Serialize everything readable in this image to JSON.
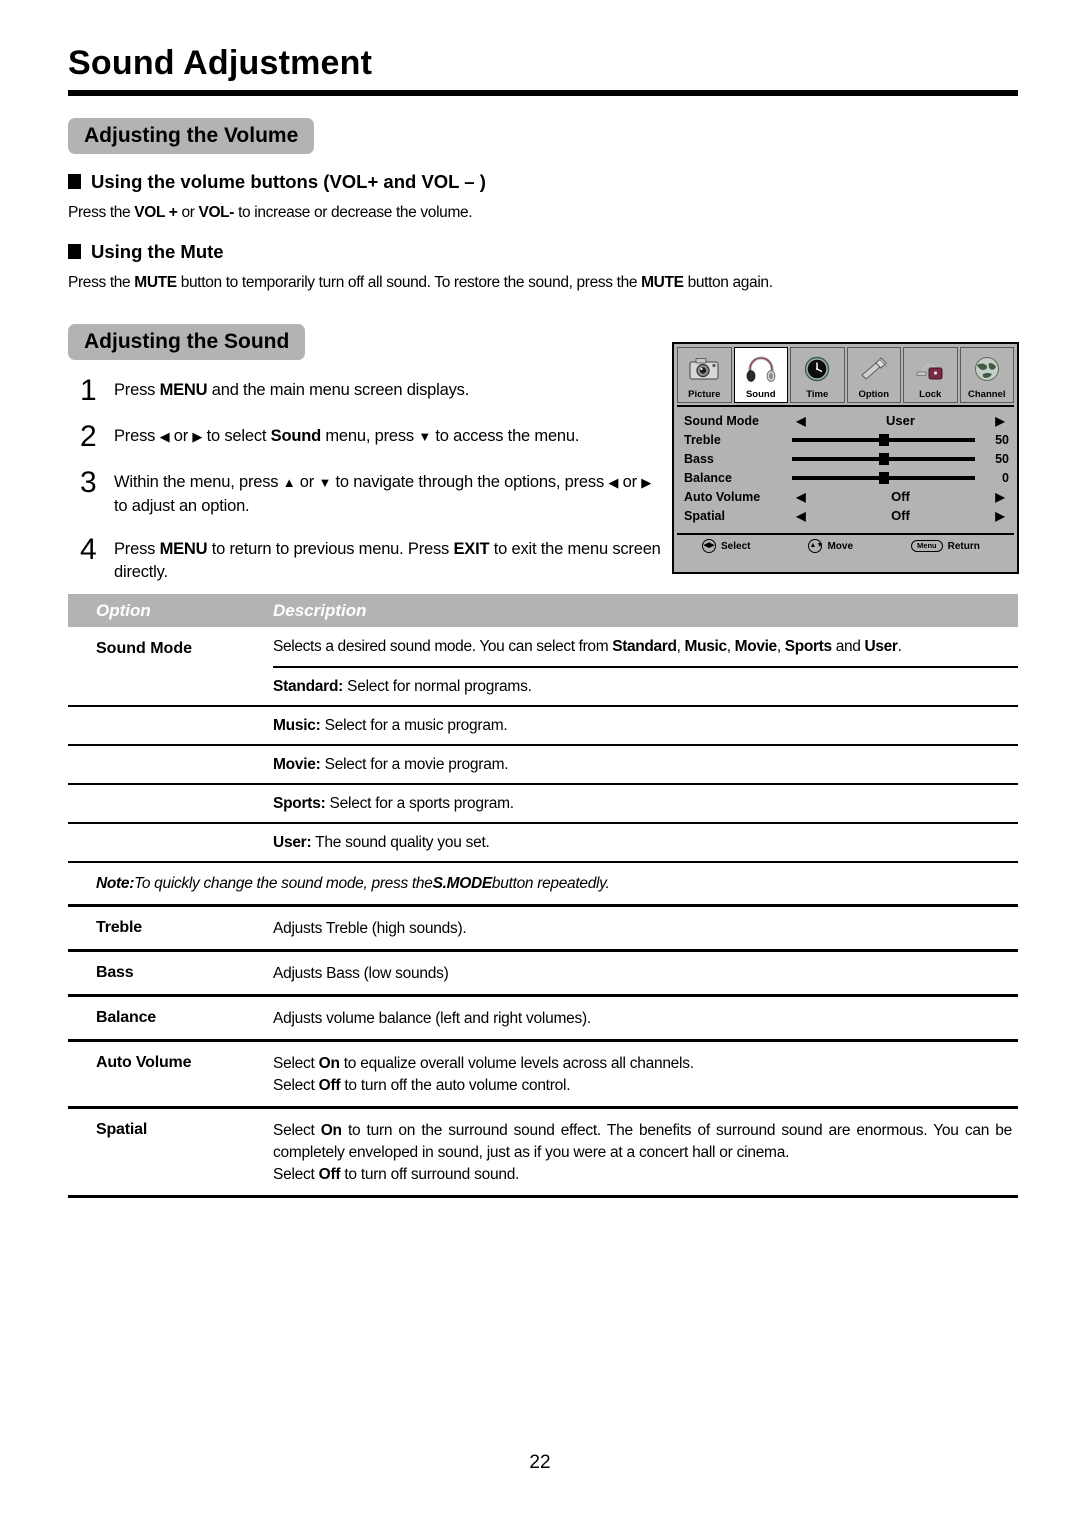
{
  "document": {
    "title": "Sound Adjustment",
    "page_number": "22"
  },
  "volume_section": {
    "badge": "Adjusting the Volume",
    "vol_buttons": {
      "heading": "Using the volume buttons (VOL+ and VOL – )",
      "body_prefix": "Press the ",
      "body_bold1": "VOL +",
      "body_mid": " or ",
      "body_bold2": "VOL-",
      "body_suffix": " to increase or decrease the volume."
    },
    "mute": {
      "heading": "Using the Mute",
      "body_prefix": "Press the ",
      "body_bold1": "MUTE",
      "body_mid": " button to temporarily turn off all sound.   To restore the sound, press the ",
      "body_bold2": "MUTE",
      "body_suffix": " button again."
    }
  },
  "sound_section": {
    "badge": "Adjusting the Sound",
    "steps": [
      {
        "number": "1",
        "prefix": "Press ",
        "bold1": "MENU",
        "suffix": " and the main menu screen displays."
      },
      {
        "number": "2",
        "prefix": "Press ",
        "arrow_left": "◀",
        "mid1": " or ",
        "arrow_right": "▶",
        "mid2": " to select ",
        "bold1": "Sound",
        "mid3": " menu,  press ",
        "arrow_down": "▼",
        "suffix": " to access the menu."
      },
      {
        "number": "3",
        "prefix": "Within the menu, press ",
        "arrow_up": "▲",
        "mid1": " or ",
        "arrow_down": "▼",
        "mid2": " to navigate through the options, press ",
        "arrow_left": "◀",
        "mid3": " or ",
        "arrow_right": "▶",
        "suffix": " to adjust an option."
      },
      {
        "number": "4",
        "prefix": "Press ",
        "bold1": "MENU",
        "mid1": " to return to previous menu. Press ",
        "bold2": "EXIT",
        "suffix": " to exit the menu screen directly."
      }
    ]
  },
  "osd": {
    "tabs": [
      {
        "label": "Picture",
        "icon": "camera-icon",
        "active": false
      },
      {
        "label": "Sound",
        "icon": "headphones-icon",
        "active": true
      },
      {
        "label": "Time",
        "icon": "clock-icon",
        "active": false
      },
      {
        "label": "Option",
        "icon": "tools-icon",
        "active": false
      },
      {
        "label": "Lock",
        "icon": "padlock-icon",
        "active": false
      },
      {
        "label": "Channel",
        "icon": "globe-icon",
        "active": false
      }
    ],
    "rows": [
      {
        "label": "Sound Mode",
        "type": "option",
        "value": "User",
        "arrow_left": "◀",
        "arrow_right": "▶"
      },
      {
        "label": "Treble",
        "type": "slider",
        "value": "50",
        "percent": 50
      },
      {
        "label": "Bass",
        "type": "slider",
        "value": "50",
        "percent": 50
      },
      {
        "label": "Balance",
        "type": "slider",
        "value": "0",
        "percent": 50
      },
      {
        "label": "Auto Volume",
        "type": "option",
        "value": "Off",
        "arrow_left": "◀",
        "arrow_right": "▶"
      },
      {
        "label": "Spatial",
        "type": "option",
        "value": "Off",
        "arrow_left": "◀",
        "arrow_right": "▶"
      }
    ],
    "footer": {
      "select_key": "◀▶",
      "select_label": "Select",
      "move_key": "▲▼",
      "move_label": "Move",
      "return_key": "Menu",
      "return_label": "Return"
    }
  },
  "table": {
    "headers": {
      "option": "Option",
      "description": "Description"
    },
    "sound_mode": {
      "label": "Sound Mode",
      "description_prefix": "Selects a desired sound mode.  You can select from ",
      "modes_inline": [
        "Standard",
        "Music",
        "Movie",
        "Sports"
      ],
      "description_join": ", ",
      "description_and": " and ",
      "last_mode": "User",
      "description_suffix": ".",
      "sub_rows": [
        {
          "bold": "Standard:",
          "text": " Select for normal programs."
        },
        {
          "bold": "Music:",
          "text": " Select for a music program."
        },
        {
          "bold": "Movie:",
          "text": " Select for a movie program."
        },
        {
          "bold": "Sports:",
          "text": " Select for a sports program."
        },
        {
          "bold": "User:",
          "text": " The sound quality you set."
        }
      ]
    },
    "note": {
      "bold": "Note:",
      "text_before": " To quickly change the sound mode, press the ",
      "bold2": "S.MODE",
      "text_after": " button repeatedly."
    },
    "rows": [
      {
        "option": "Treble",
        "lines": [
          {
            "text": "Adjusts Treble (high sounds)."
          }
        ]
      },
      {
        "option": "Bass",
        "lines": [
          {
            "text": "Adjusts Bass (low sounds)"
          }
        ]
      },
      {
        "option": "Balance",
        "lines": [
          {
            "text": "Adjusts volume balance (left and right volumes)."
          }
        ]
      },
      {
        "option": "Auto Volume",
        "lines": [
          {
            "prefix": "Select ",
            "bold": "On",
            "suffix": " to equalize overall volume levels across all channels."
          },
          {
            "prefix": "Select ",
            "bold": "Off",
            "suffix": " to turn off the auto volume control."
          }
        ]
      },
      {
        "option": "Spatial",
        "lines": [
          {
            "prefix": "Select ",
            "bold": "On",
            "suffix": " to turn on the surround sound effect. The benefits of surround sound are enormous. You can be completely enveloped in sound, just as if you were at a concert hall or cinema."
          },
          {
            "prefix": "Select ",
            "bold": "Off",
            "suffix": " to turn off surround sound."
          }
        ]
      }
    ]
  },
  "colors": {
    "badge_gray": "#b3b3b3",
    "osd_gray": "#b3b3b3",
    "rule_black": "#000000",
    "header_text_white": "#ffffff"
  }
}
